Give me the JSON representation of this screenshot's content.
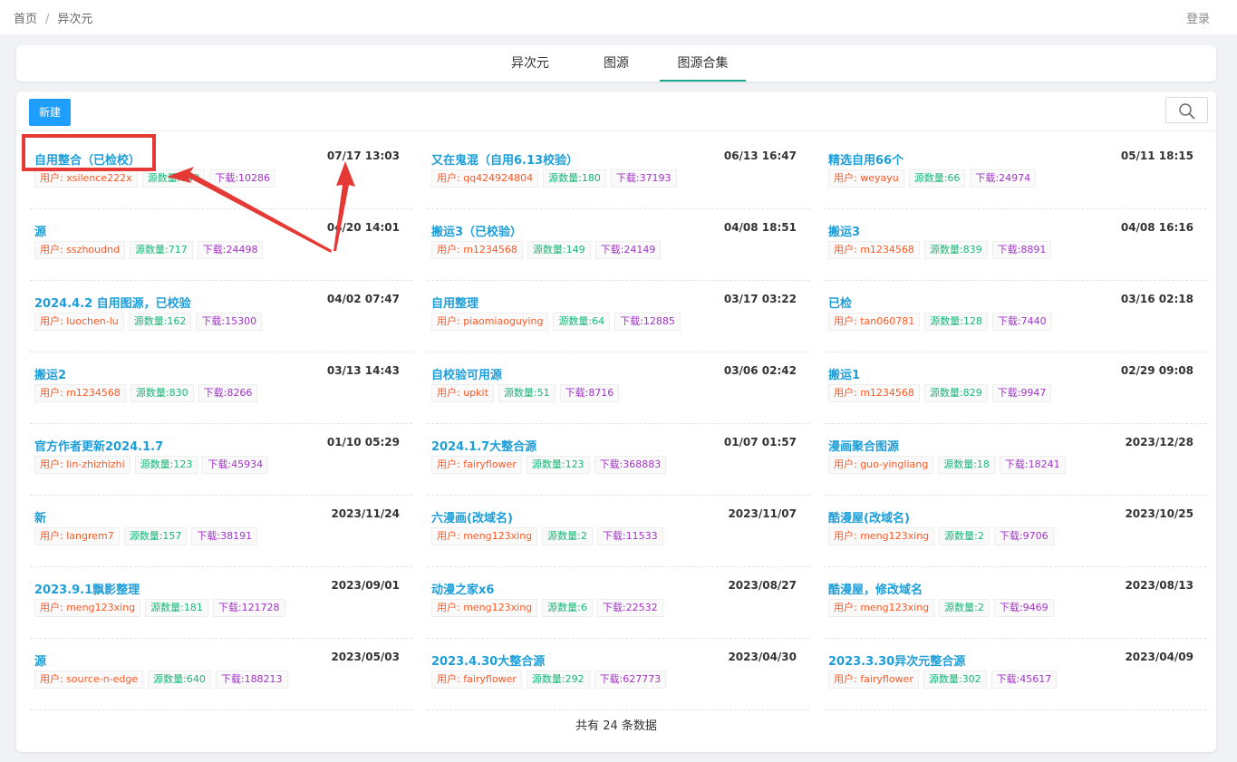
{
  "breadcrumb": {
    "home": "首页",
    "separator": "/",
    "current": "异次元"
  },
  "login": "登录",
  "tabs": [
    {
      "label": "异次元"
    },
    {
      "label": "图源"
    },
    {
      "label": "图源合集",
      "active": true
    }
  ],
  "toolbar": {
    "new_label": "新建",
    "search_icon": "search-icon"
  },
  "labels": {
    "user": "用户: ",
    "count": "源数量:",
    "downloads": "下载:"
  },
  "items": [
    {
      "title": "自用整合（已检校）",
      "time": "07/17 13:03",
      "user": "用户: xsilence222x",
      "count": "源数量:140",
      "downloads": "下载:10286"
    },
    {
      "title": "又在鬼混（自用6.13校验）",
      "time": "06/13 16:47",
      "user": "用户: qq424924804",
      "count": "源数量:180",
      "downloads": "下载:37193"
    },
    {
      "title": "精选自用66个",
      "time": "05/11 18:15",
      "user": "用户: weyayu",
      "count": "源数量:66",
      "downloads": "下载:24974"
    },
    {
      "title": "源",
      "time": "04/20 14:01",
      "user": "用户: sszhoudnd",
      "count": "源数量:717",
      "downloads": "下载:24498"
    },
    {
      "title": "搬运3（已校验）",
      "time": "04/08 18:51",
      "user": "用户: m1234568",
      "count": "源数量:149",
      "downloads": "下载:24149"
    },
    {
      "title": "搬运3",
      "time": "04/08 16:16",
      "user": "用户: m1234568",
      "count": "源数量:839",
      "downloads": "下载:8891"
    },
    {
      "title": "2024.4.2 自用图源，已校验",
      "time": "04/02 07:47",
      "user": "用户: luochen-lu",
      "count": "源数量:162",
      "downloads": "下载:15300"
    },
    {
      "title": "自用整理",
      "time": "03/17 03:22",
      "user": "用户: piaomiaoguying",
      "count": "源数量:64",
      "downloads": "下载:12885"
    },
    {
      "title": "已检",
      "time": "03/16 02:18",
      "user": "用户: tan060781",
      "count": "源数量:128",
      "downloads": "下载:7440"
    },
    {
      "title": "搬运2",
      "time": "03/13 14:43",
      "user": "用户: m1234568",
      "count": "源数量:830",
      "downloads": "下载:8266"
    },
    {
      "title": "自校验可用源",
      "time": "03/06 02:42",
      "user": "用户: upkit",
      "count": "源数量:51",
      "downloads": "下载:8716"
    },
    {
      "title": "搬运1",
      "time": "02/29 09:08",
      "user": "用户: m1234568",
      "count": "源数量:829",
      "downloads": "下载:9947"
    },
    {
      "title": "官方作者更新2024.1.7",
      "time": "01/10 05:29",
      "user": "用户: lin-zhizhizhi",
      "count": "源数量:123",
      "downloads": "下载:45934"
    },
    {
      "title": "2024.1.7大整合源",
      "time": "01/07 01:57",
      "user": "用户: fairyflower",
      "count": "源数量:123",
      "downloads": "下载:368883"
    },
    {
      "title": "漫画聚合图源",
      "time": "2023/12/28",
      "user": "用户: guo-yingliang",
      "count": "源数量:18",
      "downloads": "下载:18241"
    },
    {
      "title": "新",
      "time": "2023/11/24",
      "user": "用户: langrem7",
      "count": "源数量:157",
      "downloads": "下载:38191"
    },
    {
      "title": "六漫画(改域名)",
      "time": "2023/11/07",
      "user": "用户: meng123xing",
      "count": "源数量:2",
      "downloads": "下载:11533"
    },
    {
      "title": "酷漫屋(改域名)",
      "time": "2023/10/25",
      "user": "用户: meng123xing",
      "count": "源数量:2",
      "downloads": "下载:9706"
    },
    {
      "title": "2023.9.1飘影整理",
      "time": "2023/09/01",
      "user": "用户: meng123xing",
      "count": "源数量:181",
      "downloads": "下载:121728"
    },
    {
      "title": "动漫之家x6",
      "time": "2023/08/27",
      "user": "用户: meng123xing",
      "count": "源数量:6",
      "downloads": "下载:22532"
    },
    {
      "title": "酷漫屋，修改域名",
      "time": "2023/08/13",
      "user": "用户: meng123xing",
      "count": "源数量:2",
      "downloads": "下载:9469"
    },
    {
      "title": "源",
      "time": "2023/05/03",
      "user": "用户: source-n-edge",
      "count": "源数量:640",
      "downloads": "下载:188213"
    },
    {
      "title": "2023.4.30大整合源",
      "time": "2023/04/30",
      "user": "用户: fairyflower",
      "count": "源数量:292",
      "downloads": "下载:627773"
    },
    {
      "title": "2023.3.30异次元整合源",
      "time": "2023/04/09",
      "user": "用户: fairyflower",
      "count": "源数量:302",
      "downloads": "下载:45617"
    }
  ],
  "footer": {
    "total": "共有 24 条数据"
  },
  "colors": {
    "accent": "#1e9fff",
    "title": "#1d9ed8",
    "tab_active": "#20a98c",
    "user_tag": "#ff5722",
    "count_tag": "#16b777",
    "download_tag": "#a233c6",
    "annotation": "#e53935"
  }
}
